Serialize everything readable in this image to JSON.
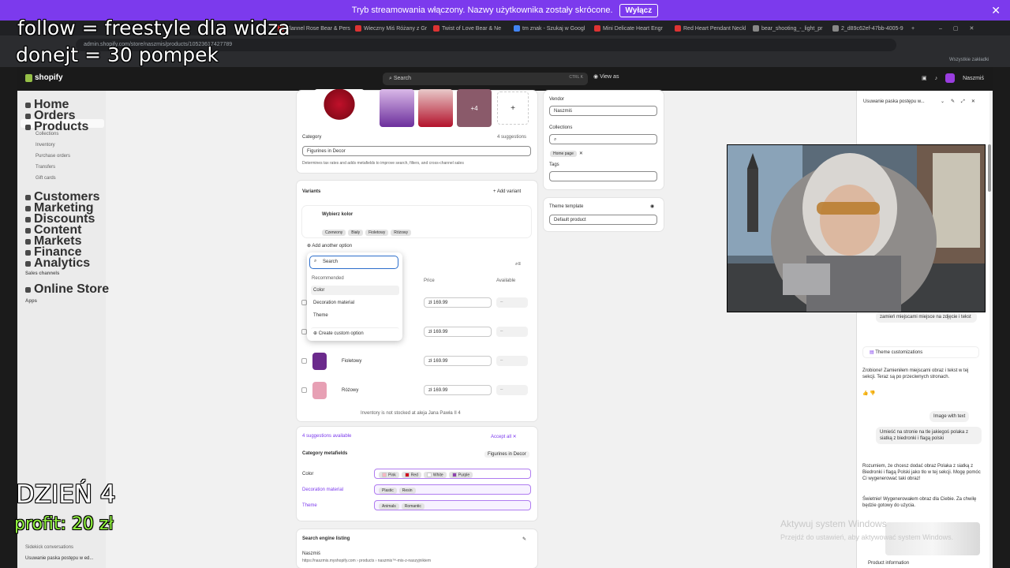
{
  "banner": {
    "text": "Tryb streamowania włączony. Nazwy użytkownika zostały skrócone.",
    "button": "Wyłącz"
  },
  "tabs": [
    "Flannel Rose Bear & Pers",
    "Wieczny Miś Różany z Gr",
    "Twist of Love Bear & Ne",
    "tm znak - Szukaj w Googl",
    "Mini Delicate Heart Engr",
    "Red Heart Pendant Neckl",
    "bear_shooting_-_light_pr",
    "2_d89c62ef-47bb-4005-9"
  ],
  "url": "admin.shopify.com/store/naszmis/products/10523617427789",
  "bookmarks": {
    "all": "Wszystkie zakładki"
  },
  "shop": {
    "logo": "shopify",
    "search": "Search",
    "search_kbd": "CTRL K",
    "view_as": "View as",
    "user": "Naszmiś"
  },
  "nav": {
    "home": "Home",
    "orders": "Orders",
    "products": "Products",
    "collections": "Collections",
    "inventory": "Inventory",
    "purchase_orders": "Purchase orders",
    "transfers": "Transfers",
    "gift_cards": "Gift cards",
    "customers": "Customers",
    "marketing": "Marketing",
    "discounts": "Discounts",
    "content": "Content",
    "markets": "Markets",
    "finance": "Finance",
    "analytics": "Analytics",
    "sales_channels": "Sales channels",
    "online_store": "Online Store",
    "apps": "Apps",
    "sidekick_conversations": "Sidekick conversations",
    "sidekick_item": "Usuwanie paska postępu w ed..."
  },
  "media": {
    "more": "+4",
    "add": "+"
  },
  "category": {
    "label": "Category",
    "suggestions": "4 suggestions",
    "value": "Figurines in Decor",
    "help": "Determines tax rates and adds metafields to improve search, filters, and cross-channel sales"
  },
  "variants": {
    "title": "Variants",
    "add_variant": "+ Add variant",
    "option_name": "Wybierz kolor",
    "option_values": [
      "Czerwony",
      "Biały",
      "Fioletowy",
      "Różowy"
    ],
    "add_option": "Add another option",
    "col_price": "Price",
    "col_available": "Available",
    "rows": [
      {
        "name": "",
        "price": "169.99"
      },
      {
        "name": "",
        "price": "169.99"
      },
      {
        "name": "Fioletowy",
        "price": "169.99"
      },
      {
        "name": "Różowy",
        "price": "169.99"
      }
    ],
    "currency": "zł",
    "inventory_note": "Inventory is not stocked at aleja Jana Pawła II 4"
  },
  "dropdown": {
    "placeholder": "Search",
    "recommended": "Recommended",
    "items": [
      "Color",
      "Decoration material",
      "Theme"
    ],
    "create": "Create custom option"
  },
  "suggestions": {
    "label": "4 suggestions available",
    "accept": "Accept all"
  },
  "metafields": {
    "title": "Category metafields",
    "badge": "Figurines in Decor",
    "color_label": "Color",
    "colors": [
      {
        "name": "Pink",
        "hex": "#f4b6c2"
      },
      {
        "name": "Red",
        "hex": "#d0021b"
      },
      {
        "name": "White",
        "hex": "#ffffff"
      },
      {
        "name": "Purple",
        "hex": "#8e44ad"
      }
    ],
    "decoration_label": "Decoration material",
    "decoration": [
      "Plastic",
      "Resin"
    ],
    "theme_label": "Theme",
    "theme": [
      "Animals",
      "Romantic"
    ]
  },
  "seo": {
    "title": "Search engine listing",
    "name": "Naszmiś",
    "url": "https://naszmis.myshopify.com › products › naszmis™-mis-z-naszyjnikiem"
  },
  "org": {
    "vendor_label": "Vendor",
    "vendor": "Naszmiś",
    "collections_label": "Collections",
    "collection_chip": "Home page",
    "tags_label": "Tags"
  },
  "theme_template": {
    "label": "Theme template",
    "value": "Default product"
  },
  "sidekick": {
    "title": "Usuwanie paska postępu w...",
    "msg1": "zamień miejscami miejsce na zdjęcie i tekst",
    "theme_custom": "Theme customizations",
    "reply1": "Zrobione! Zamieniłem miejscami obraz i tekst w tej sekcji. Teraz są po przeciwnych stronach.",
    "image_text": "Image with text",
    "msg2": "Umieść na stronie na tle jakiegoś polaka z siatką z biedronki i flagą polski",
    "reply2": "Rozumiem, że chcesz dodać obraz Polaka z siatką z Biedronki i flagą Polski jako tło w tej sekcji. Mogę pomóc Ci wygenerować taki obraz!",
    "reply3": "Świetnie! Wygenerowałem obraz dla Ciebie. Za chwilę będzie gotowy do użycia.",
    "product_info": "Product information"
  },
  "overlay": {
    "line1": "follow = freestyle dla widza",
    "line2": "donejt = 30 pompek",
    "day": "DZIEŃ 4",
    "profit": "profit: 20 zł"
  },
  "windows": {
    "activate": "Aktywuj system Windows",
    "settings": "Przejdź do ustawień, aby aktywować system Windows."
  }
}
